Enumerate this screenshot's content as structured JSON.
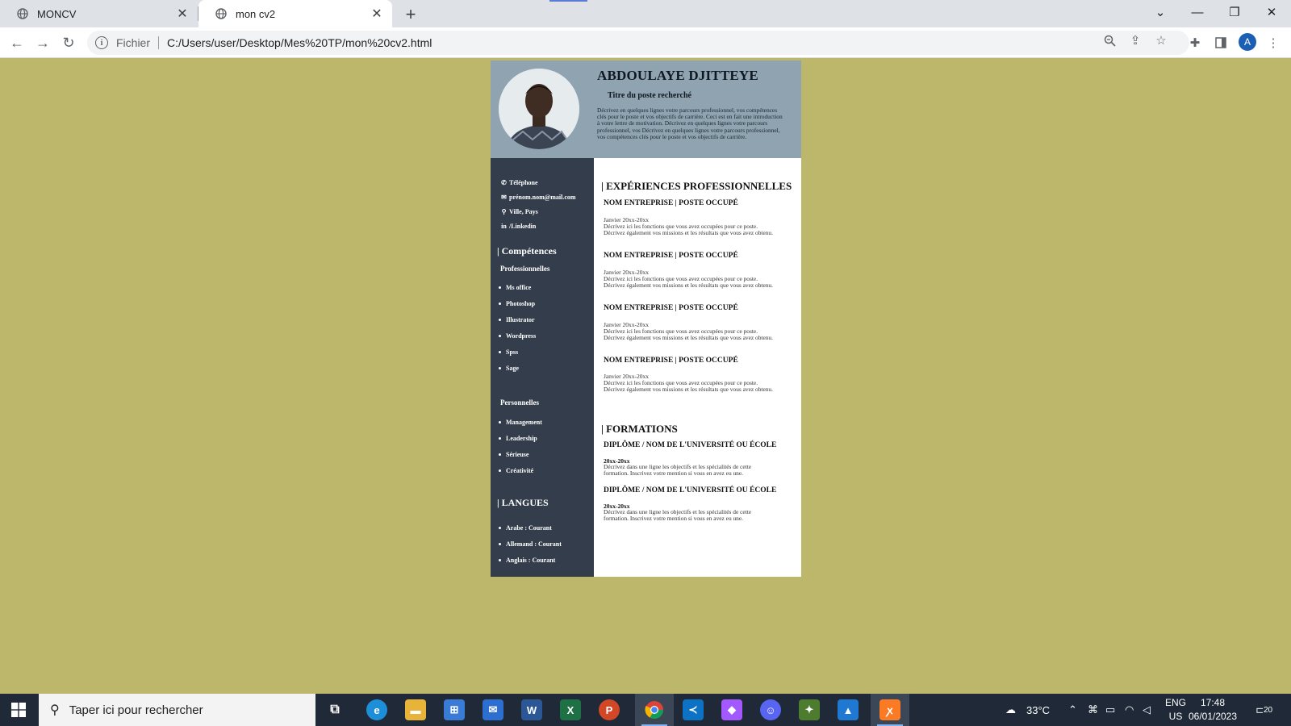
{
  "browser": {
    "tabs": [
      {
        "title": "MONCV",
        "active": false,
        "icon": "globe-icon"
      },
      {
        "title": "mon cv2",
        "active": true,
        "icon": "globe-icon"
      }
    ],
    "address": {
      "scheme_label": "Fichier",
      "url": "C:/Users/user/Desktop/Mes%20TP/mon%20cv2.html"
    },
    "profile_initial": "A"
  },
  "cv": {
    "name": "ABDOULAYE DJITTEYE",
    "job_title": "Titre du poste recherché",
    "intro": "Décrivez en quelques lignes votre parcours professionnel, vos compétences clés pour le poste et vos objectifs de carrière. Ceci est en fait une introduction à votre lettre de motivation. Décrivez en quelques lignes votre parcours professionnel, vos Décrivez en quelques lignes votre parcours professionnel, vos compétences clés pour le poste et vos objectifs de carrière.",
    "contact": {
      "phone": "Téléphone",
      "email": "prénom.nom@mail.com",
      "location": "Ville, Pays",
      "linkedin": "/Linkedin"
    },
    "skills_heading": "| Compétences",
    "professional_heading": "Professionnelles",
    "professional_skills": [
      "Ms office",
      "Photoshop",
      "Illustrator",
      "Wordpress",
      "Spss",
      "Sage"
    ],
    "personal_heading": "Personnelles",
    "personal_skills": [
      "Management",
      "Leadership",
      "Sérieuse",
      "Créativité"
    ],
    "languages_heading": "| LANGUES",
    "languages": [
      "Arabe : Courant",
      "Allemand : Courant",
      "Anglais : Courant"
    ],
    "experience_heading": "| EXPÉRIENCES PROFESSIONNELLES",
    "experiences": [
      {
        "title": "NOM ENTREPRISE | POSTE OCCUPÉ",
        "date": "Janvier 20xx-20xx",
        "description": "Décrivez ici les fonctions que vous avez occupées pour ce poste. Décrivez également vos missions et les résultats que vous avez obtenu."
      },
      {
        "title": "NOM ENTREPRISE | POSTE OCCUPÉ",
        "date": "Janvier 20xx-20xx",
        "description": "Décrivez ici les fonctions que vous avez occupées pour ce poste. Décrivez également vos missions et les résultats que vous avez obtenu."
      },
      {
        "title": "NOM ENTREPRISE | POSTE OCCUPÉ",
        "date": "Janvier 20xx-20xx",
        "description": "Décrivez ici les fonctions que vous avez occupées pour ce poste. Décrivez également vos missions et les résultats que vous avez obtenu."
      },
      {
        "title": "NOM ENTREPRISE | POSTE OCCUPÉ",
        "date": "Janvier 20xx-20xx",
        "description": "Décrivez ici les fonctions que vous avez occupées pour ce poste. Décrivez également vos missions et les résultats que vous avez obtenu."
      }
    ],
    "education_heading": "| FORMATIONS",
    "education": [
      {
        "title": "DIPLÔME / NOM DE L'UNIVERSITÉ OU ÉCOLE",
        "date": "20xx-20xx",
        "description": "Décrivez dans une ligne les objectifs et les spécialités de cette formation. Inscrivez votre mention si vous en avez eu une."
      },
      {
        "title": "DIPLÔME / NOM DE L'UNIVERSITÉ OU ÉCOLE",
        "date": "20xx-20xx",
        "description": "Décrivez dans une ligne les objectifs et les spécialités de cette formation. Inscrivez votre mention si vous en avez eu une."
      }
    ]
  },
  "taskbar": {
    "search_placeholder": "Taper ici pour rechercher",
    "apps": [
      "task-view-icon",
      "edge-icon",
      "file-explorer-icon",
      "store-icon",
      "mail-icon",
      "word-icon",
      "excel-icon",
      "powerpoint-icon",
      "chrome-icon",
      "vscode-icon",
      "figma-icon",
      "discord-icon",
      "app-icon",
      "photos-icon",
      "xampp-icon"
    ],
    "temperature": "33°C",
    "language_top": "ENG",
    "language_bottom": "US",
    "time": "17:48",
    "date": "06/01/2023",
    "notification_count": "20"
  },
  "colors": {
    "page_background": "#bdb76b",
    "cv_header": "#8fa3b0",
    "cv_sidebar": "#343d4b",
    "taskbar": "#1f2937"
  }
}
